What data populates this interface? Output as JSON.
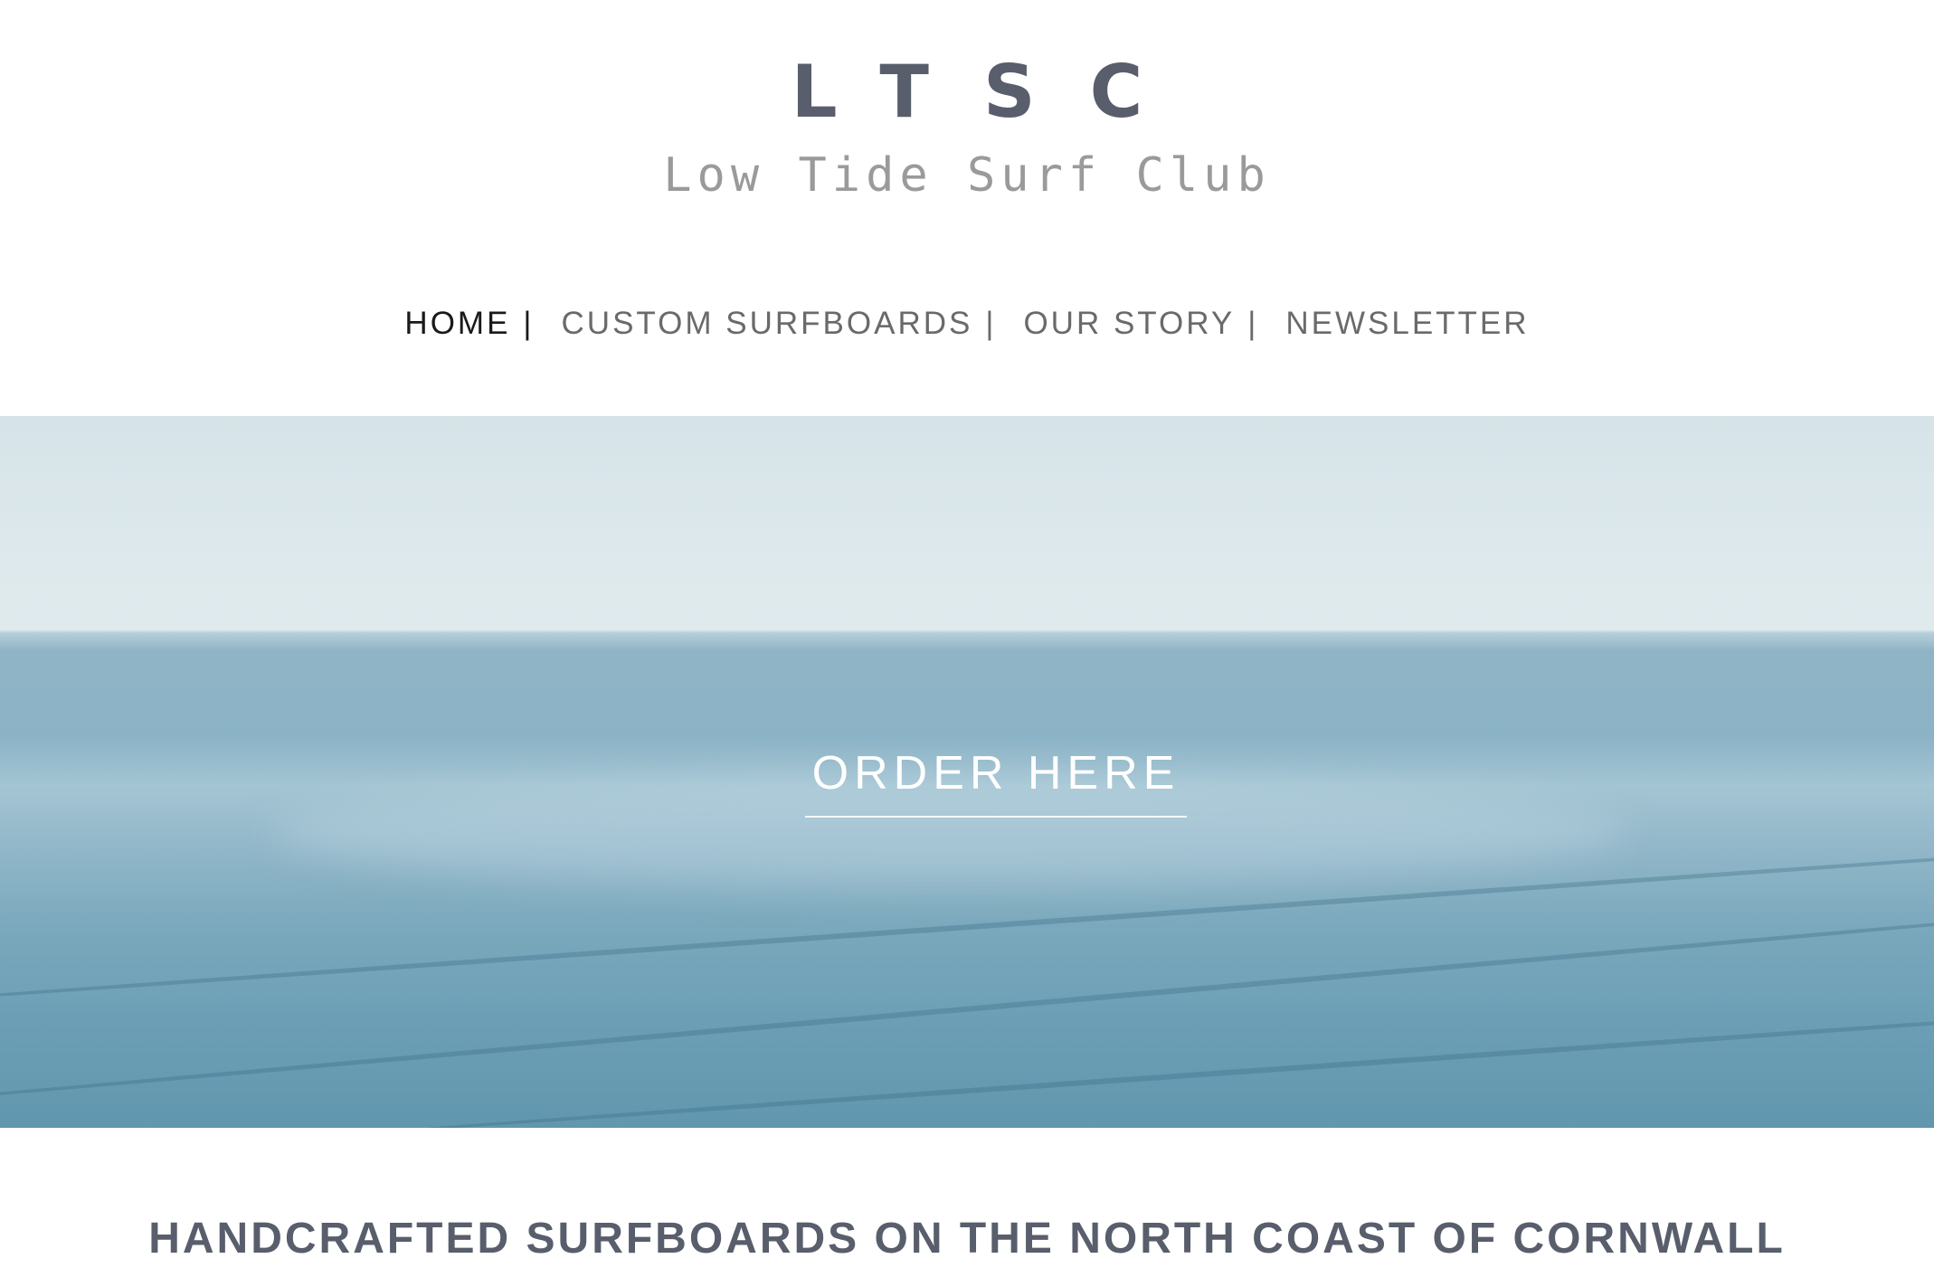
{
  "site": {
    "logo": "LTSC",
    "tagline": "Low Tide Surf Club"
  },
  "nav": {
    "items": [
      {
        "label": "HOME",
        "active": true
      },
      {
        "label": "CUSTOM SURFBOARDS",
        "active": false
      },
      {
        "label": "OUR STORY",
        "active": false
      },
      {
        "label": "NEWSLETTER",
        "active": false
      }
    ],
    "separator": "|"
  },
  "hero": {
    "cta_label": "ORDER HERE",
    "image": "ocean-horizon-photo"
  },
  "headline": "HANDCRAFTED SURFBOARDS ON THE NORTH COAST OF CORNWALL",
  "colors": {
    "logo": "#585e6b",
    "tagline": "#9a9a9a",
    "nav_active": "#1a1a1a",
    "nav_inactive": "#6a6a6a",
    "sky": "#dde9ec",
    "sea": "#8bb3c6",
    "cta_text": "#ffffff"
  }
}
